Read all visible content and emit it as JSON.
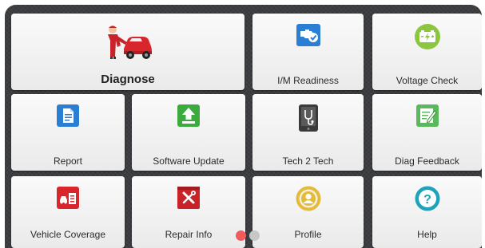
{
  "tiles": {
    "diagnose": {
      "label": "Diagnose",
      "icon": "mechanic-car-icon"
    },
    "im_readiness": {
      "label": "I/M Readiness",
      "icon": "engine-check-icon"
    },
    "voltage_check": {
      "label": "Voltage Check",
      "icon": "battery-icon"
    },
    "report": {
      "label": "Report",
      "icon": "document-icon"
    },
    "software_update": {
      "label": "Software Update",
      "icon": "upload-icon"
    },
    "tech2tech": {
      "label": "Tech 2 Tech",
      "icon": "tablet-stethoscope-icon"
    },
    "diag_feedback": {
      "label": "Diag Feedback",
      "icon": "edit-note-icon"
    },
    "vehicle_coverage": {
      "label": "Vehicle Coverage",
      "icon": "car-list-icon"
    },
    "repair_info": {
      "label": "Repair Info",
      "icon": "tools-book-icon"
    },
    "profile": {
      "label": "Profile",
      "icon": "user-profile-icon"
    },
    "help": {
      "label": "Help",
      "icon": "question-icon"
    }
  },
  "pager": {
    "pages": 2,
    "current": 1,
    "active_color": "#f25b5b",
    "inactive_color": "#c7c7c7"
  }
}
